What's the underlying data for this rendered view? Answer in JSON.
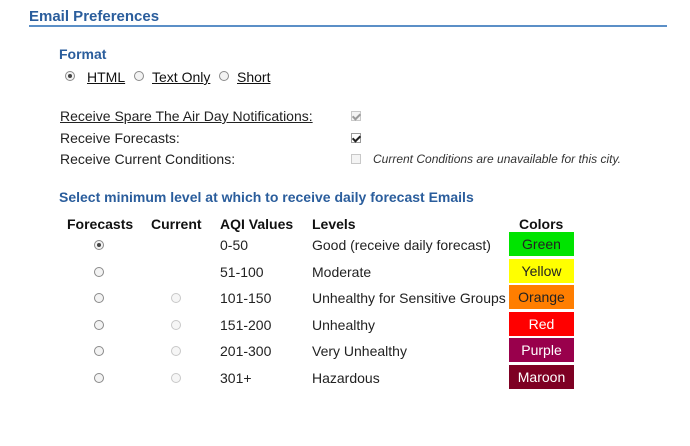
{
  "section": {
    "title": "Email Preferences"
  },
  "format": {
    "title": "Format",
    "options": [
      {
        "label": "HTML",
        "checked": true
      },
      {
        "label": "Text Only",
        "checked": false
      },
      {
        "label": "Short",
        "checked": false
      }
    ]
  },
  "notifications": {
    "spare_the_air": {
      "label": "Receive Spare The Air Day Notifications:",
      "checked": true,
      "disabled": true
    },
    "forecasts": {
      "label": "Receive Forecasts:",
      "checked": true,
      "disabled": false
    },
    "current_conditions": {
      "label": "Receive Current Conditions:",
      "checked": false,
      "disabled": true,
      "note": "Current Conditions are unavailable for this city."
    }
  },
  "levels": {
    "title": "Select minimum level at which to receive daily forecast Emails",
    "headers": {
      "forecasts": "Forecasts",
      "current": "Current",
      "aqi": "AQI Values",
      "levels": "Levels",
      "colors": "Colors"
    },
    "rows": [
      {
        "aqi": "0-50",
        "level": "Good (receive daily forecast)",
        "color": "Green",
        "bg": "#00e400",
        "fg": "#222222",
        "forecast_checked": true,
        "current": false
      },
      {
        "aqi": "51-100",
        "level": "Moderate",
        "color": "Yellow",
        "bg": "#ffff00",
        "fg": "#222222",
        "forecast_checked": false,
        "current": false
      },
      {
        "aqi": "101-150",
        "level": "Unhealthy for Sensitive Groups",
        "color": "Orange",
        "bg": "#ff7e00",
        "fg": "#222222",
        "forecast_checked": false,
        "current": true
      },
      {
        "aqi": "151-200",
        "level": "Unhealthy",
        "color": "Red",
        "bg": "#ff0000",
        "fg": "#ffffff",
        "forecast_checked": false,
        "current": true
      },
      {
        "aqi": "201-300",
        "level": "Very Unhealthy",
        "color": "Purple",
        "bg": "#99004c",
        "fg": "#ffffff",
        "forecast_checked": false,
        "current": true
      },
      {
        "aqi": "301+",
        "level": "Hazardous",
        "color": "Maroon",
        "bg": "#7e0023",
        "fg": "#ffffff",
        "forecast_checked": false,
        "current": true
      }
    ]
  }
}
